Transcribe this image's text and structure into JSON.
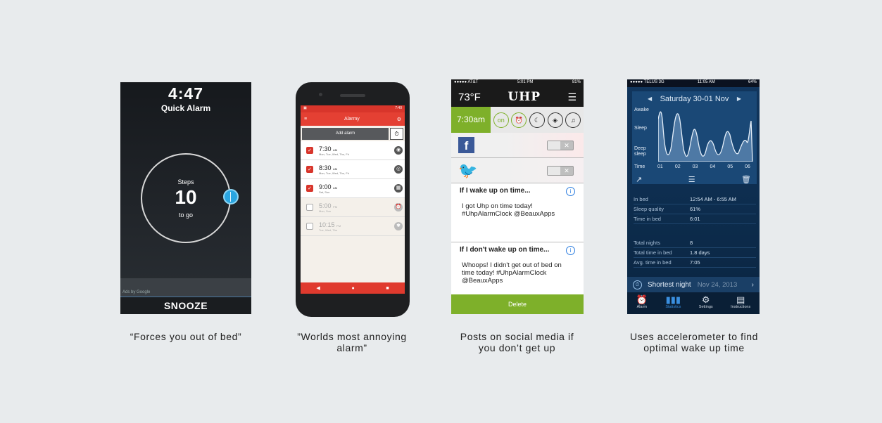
{
  "captions": [
    "“Forces you out of bed”",
    "”Worlds most annoying alarm”",
    "Posts on social media if you don’t get up",
    "Uses accelerometer to find optimal wake up time"
  ],
  "quick_alarm": {
    "time": "4:47",
    "title": "Quick Alarm",
    "steps_label": "Steps",
    "steps_count": "10",
    "to_go": "to go",
    "ads_label": "Ads by Google",
    "snooze_label": "SNOOZE"
  },
  "alarmy": {
    "status_time": "7:40",
    "app_title": "Alarmy",
    "add_alarm_label": "Add alarm",
    "alarms": [
      {
        "time": "7:30",
        "ampm": "AM",
        "days": "Mon, Tue, Wed, Thu, Fri",
        "enabled": true
      },
      {
        "time": "8:30",
        "ampm": "AM",
        "days": "Mon, Tue, Wed, Thu, Fri",
        "enabled": true
      },
      {
        "time": "9:00",
        "ampm": "AM",
        "days": "Sat, Sun",
        "enabled": true
      },
      {
        "time": "5:00",
        "ampm": "PM",
        "days": "Mon, Sun",
        "enabled": false
      },
      {
        "time": "10:15",
        "ampm": "PM",
        "days": "Tue, Wed, Thu",
        "enabled": false
      }
    ]
  },
  "uhp": {
    "status": {
      "carrier": "●●●●● AT&T",
      "time": "5:01 PM",
      "battery": "81%"
    },
    "temperature": "73°F",
    "logo": "UHP",
    "alarm_time": "7:30am",
    "on_label": "on",
    "msg1_title": "If I wake up on time...",
    "msg1_body": "I got Uhp on time today! #UhpAlarmClock @BeauxApps",
    "msg2_title": "If I don't wake up on time...",
    "msg2_body": "Whoops! I didn't get out of bed on time today!  #UhpAlarmClock @BeauxApps",
    "delete_label": "Delete",
    "accent_color": "#7eb02a"
  },
  "sleep": {
    "status": {
      "carrier": "●●●●● TELUS  3G",
      "time": "11:05 AM",
      "battery": "64%"
    },
    "date_title": "Saturday 30-01 Nov",
    "y_labels": {
      "awake": "Awake",
      "sleep": "Sleep",
      "deep": "Deep sleep",
      "time": "Time"
    },
    "x_ticks": [
      "01",
      "02",
      "03",
      "04",
      "05",
      "06"
    ],
    "stats": [
      {
        "label": "In bed",
        "value": "12:54 AM - 6:55 AM"
      },
      {
        "label": "Sleep quality",
        "value": "61%"
      },
      {
        "label": "Time in bed",
        "value": "6:01"
      }
    ],
    "totals": [
      {
        "label": "Total nights",
        "value": "8"
      },
      {
        "label": "Total time in bed",
        "value": "1.8 days"
      },
      {
        "label": "Avg. time in bed",
        "value": "7:05"
      }
    ],
    "shortest_label": "Shortest night",
    "shortest_date": "Nov 24, 2013",
    "tabs": [
      "Alarm",
      "Statistics",
      "Settings",
      "Instructions"
    ]
  }
}
